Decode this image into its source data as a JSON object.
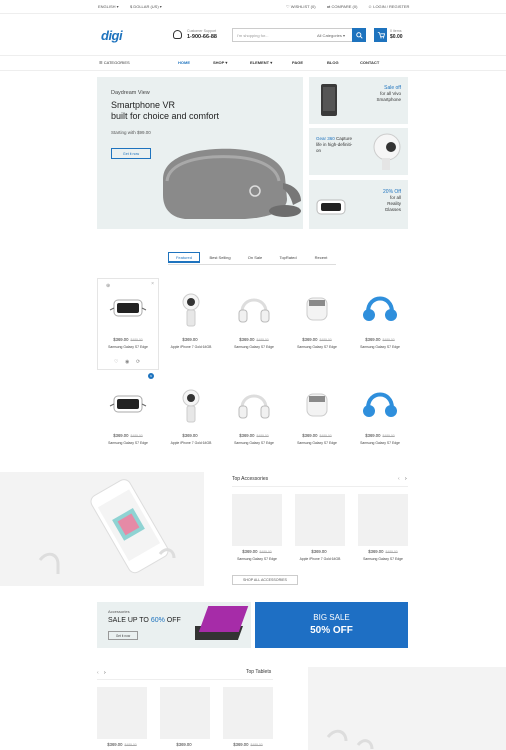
{
  "topbar": {
    "language": "ENGLISH",
    "currency": "$ DOLLAR (US)",
    "wishlist": "WISHLIST (0)",
    "compare": "COMPARE (0)",
    "login": "LOGIN / REGISTER"
  },
  "header": {
    "logo": "digi",
    "support_label": "Customer Support",
    "support_phone": "1-900-66-88",
    "search_placeholder": "I'm shopping for...",
    "category_select": "All Categories",
    "cart_label": "0 items",
    "cart_total": "$0.00"
  },
  "nav": {
    "categories": "CATEGORIES",
    "items": [
      "HOME",
      "SHOP",
      "ELEMENT",
      "PAGE",
      "BLOG",
      "CONTACT"
    ]
  },
  "hero": {
    "subtitle": "Daydream View",
    "title_line1": "Smartphone VR",
    "title_line2": "built for choice and comfort",
    "price": "Starting with $99.00",
    "button": "Get it now"
  },
  "side_banners": [
    {
      "line1": "Sale off",
      "line2": "for all Vivo",
      "line3": "Smartphone"
    },
    {
      "line1": "Gear 360",
      "line1b": " Capture",
      "line2": "life in high-definiti-",
      "line3": "on"
    },
    {
      "line1": "20% Off",
      "line2": "for all",
      "line3": "Reality",
      "line4": "Glasses"
    }
  ],
  "tabs": [
    "Featured",
    "Best Selling",
    "On Sale",
    "TopRated",
    "Recent"
  ],
  "products": [
    {
      "name": "Samsung Galaxy S7 Edge",
      "price": "$369.00",
      "old": "$489.00"
    },
    {
      "name": "Apple iPhone 7 Gold 64GB",
      "price": "$369.00",
      "old": ""
    },
    {
      "name": "Samsung Galaxy S7 Edge",
      "price": "$369.00",
      "old": "$489.00"
    },
    {
      "name": "Samsung Galaxy S7 Edge",
      "price": "$369.00",
      "old": "$489.00"
    },
    {
      "name": "Samsung Galaxy S7 Edge",
      "price": "$369.00",
      "old": "$489.00"
    },
    {
      "name": "Samsung Galaxy S7 Edge",
      "price": "$369.00",
      "old": "$489.00"
    },
    {
      "name": "Apple iPhone 7 Gold 64GB",
      "price": "$369.00",
      "old": ""
    },
    {
      "name": "Samsung Galaxy S7 Edge",
      "price": "$369.00",
      "old": "$489.00"
    },
    {
      "name": "Samsung Galaxy S7 Edge",
      "price": "$369.00",
      "old": "$489.00"
    },
    {
      "name": "Samsung Galaxy S7 Edge",
      "price": "$369.00",
      "old": "$489.00"
    }
  ],
  "accessories": {
    "title": "Top Accessories",
    "items": [
      {
        "name": "Samsung Galaxy S7 Edge",
        "price": "$369.00",
        "old": "$489.00"
      },
      {
        "name": "Apple iPhone 7 Gold 64GB",
        "price": "$369.00",
        "old": ""
      },
      {
        "name": "Samsung Galaxy S7 Edge",
        "price": "$369.00",
        "old": "$489.00"
      }
    ],
    "button": "SHOP ALL ACCESSORIES"
  },
  "promo": {
    "left_small": "Accessories",
    "left_title": "SALE UP TO ",
    "left_pct": "60%",
    "left_off": " OFF",
    "left_button": "Get it now",
    "right_line1": "BIG SALE",
    "right_line2": "50% OFF"
  },
  "tablets": {
    "title": "Top Tablets",
    "items": [
      {
        "price": "$369.00",
        "old": "$489.00"
      },
      {
        "price": "$369.00",
        "old": ""
      },
      {
        "price": "$369.00",
        "old": "$489.00"
      }
    ]
  },
  "colors": {
    "accent": "#1e73be",
    "hero_bg": "#eaf0f0",
    "promo_blue": "#1e6fc4"
  }
}
